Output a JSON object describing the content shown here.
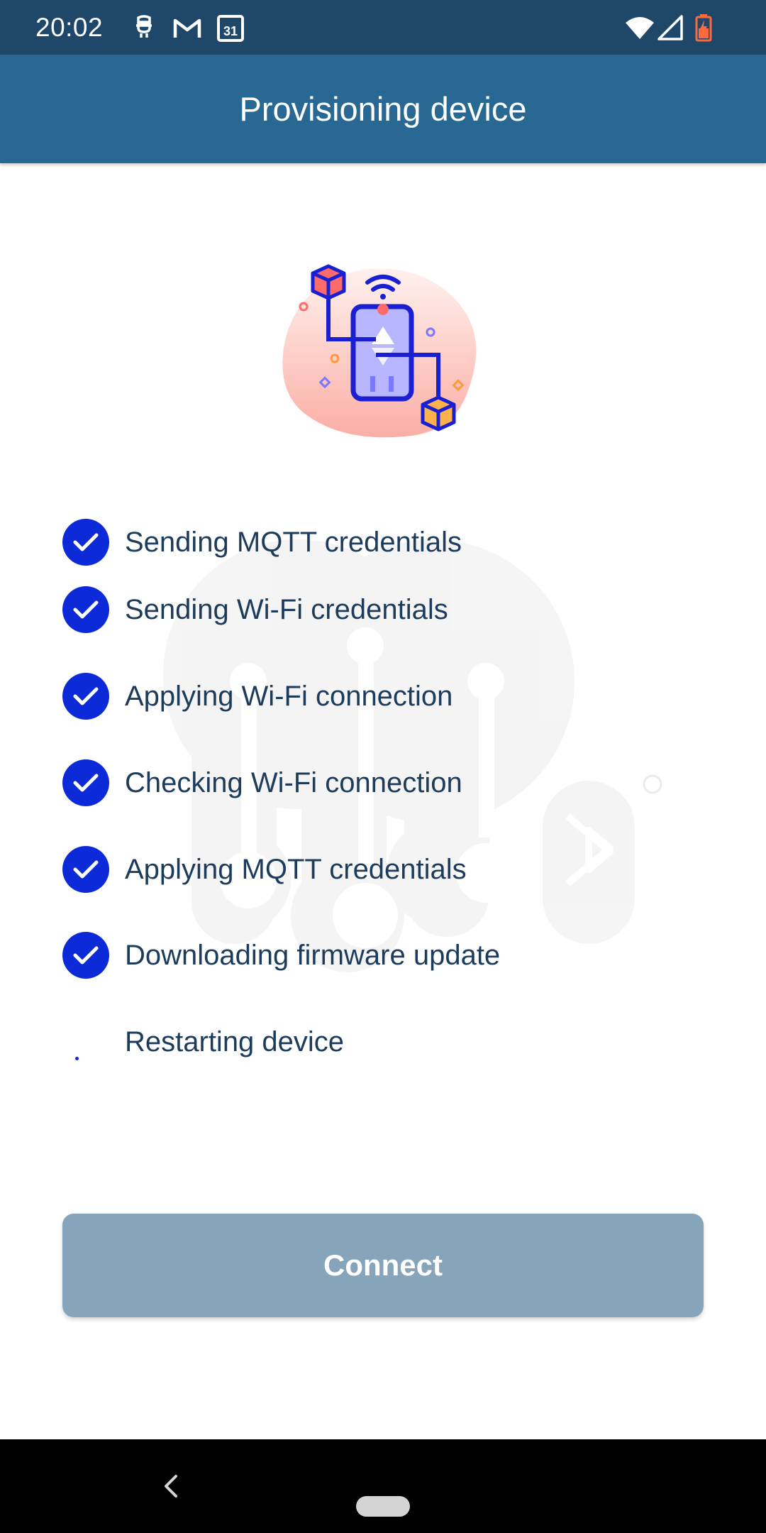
{
  "status_bar": {
    "time": "20:02",
    "left_icons": [
      "notification-icon",
      "gmail-icon",
      "calendar-icon"
    ],
    "calendar_day": "31",
    "right_icons": [
      "wifi-icon",
      "signal-icon",
      "battery-charging-icon"
    ],
    "battery_color": "#ff6a3d"
  },
  "app_bar": {
    "title": "Provisioning device",
    "color": "#286893"
  },
  "steps": [
    {
      "label": "Sending MQTT credentials",
      "status": "done"
    },
    {
      "label": "Sending Wi-Fi credentials",
      "status": "done"
    },
    {
      "label": "Applying Wi-Fi connection",
      "status": "done"
    },
    {
      "label": "Checking Wi-Fi connection",
      "status": "done"
    },
    {
      "label": "Applying MQTT credentials",
      "status": "done"
    },
    {
      "label": "Downloading firmware update",
      "status": "done"
    },
    {
      "label": "Restarting device",
      "status": "in-progress"
    }
  ],
  "check_color": "#0d2ad8",
  "connect_button": {
    "label": "Connect",
    "enabled": false,
    "color": "#86a5bb"
  },
  "nav_bar": {
    "icons": [
      "back-icon",
      "home-pill-icon"
    ]
  }
}
